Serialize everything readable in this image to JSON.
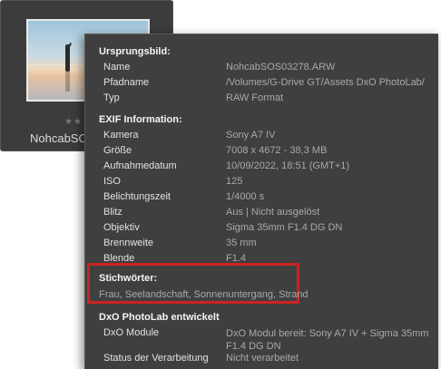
{
  "thumbnail": {
    "stars": "★★",
    "filename": "NohcabSOS"
  },
  "origin": {
    "title": "Ursprungsbild:",
    "rows": [
      {
        "key": "Name",
        "value": "NohcabSOS03278.ARW"
      },
      {
        "key": "Pfadname",
        "value": "/Volumes/G-Drive GT/Assets DxO PhotoLab/"
      },
      {
        "key": "Typ",
        "value": "RAW Format"
      }
    ]
  },
  "exif": {
    "title": "EXIF Information:",
    "rows": [
      {
        "key": "Kamera",
        "value": "Sony A7 IV"
      },
      {
        "key": "Größe",
        "value": "7008 x 4672 - 38,3 MB"
      },
      {
        "key": "Aufnahmedatum",
        "value": "10/09/2022, 18:51 (GMT+1)"
      },
      {
        "key": "ISO",
        "value": "125"
      },
      {
        "key": "Belichtungszeit",
        "value": "1/4000 s"
      },
      {
        "key": "Blitz",
        "value": "Aus | Nicht ausgelöst"
      },
      {
        "key": "Objektiv",
        "value": "Sigma 35mm F1.4 DG DN"
      },
      {
        "key": "Brennweite",
        "value": "35 mm"
      },
      {
        "key": "Blende",
        "value": "F1.4"
      }
    ]
  },
  "keywords": {
    "title": "Stichwörter:",
    "value": "Frau, Seelandschaft, Sonnenuntergang, Strand",
    "highlight_color": "#cc2222"
  },
  "dxo": {
    "title": "DxO PhotoLab entwickelt",
    "rows": [
      {
        "key": "DxO Module",
        "value": "DxO Modul bereit: Sony A7 IV + Sigma 35mm F1.4 DG DN"
      },
      {
        "key": "Status der Verarbeitung",
        "value": "Nicht verarbeitet"
      }
    ]
  }
}
